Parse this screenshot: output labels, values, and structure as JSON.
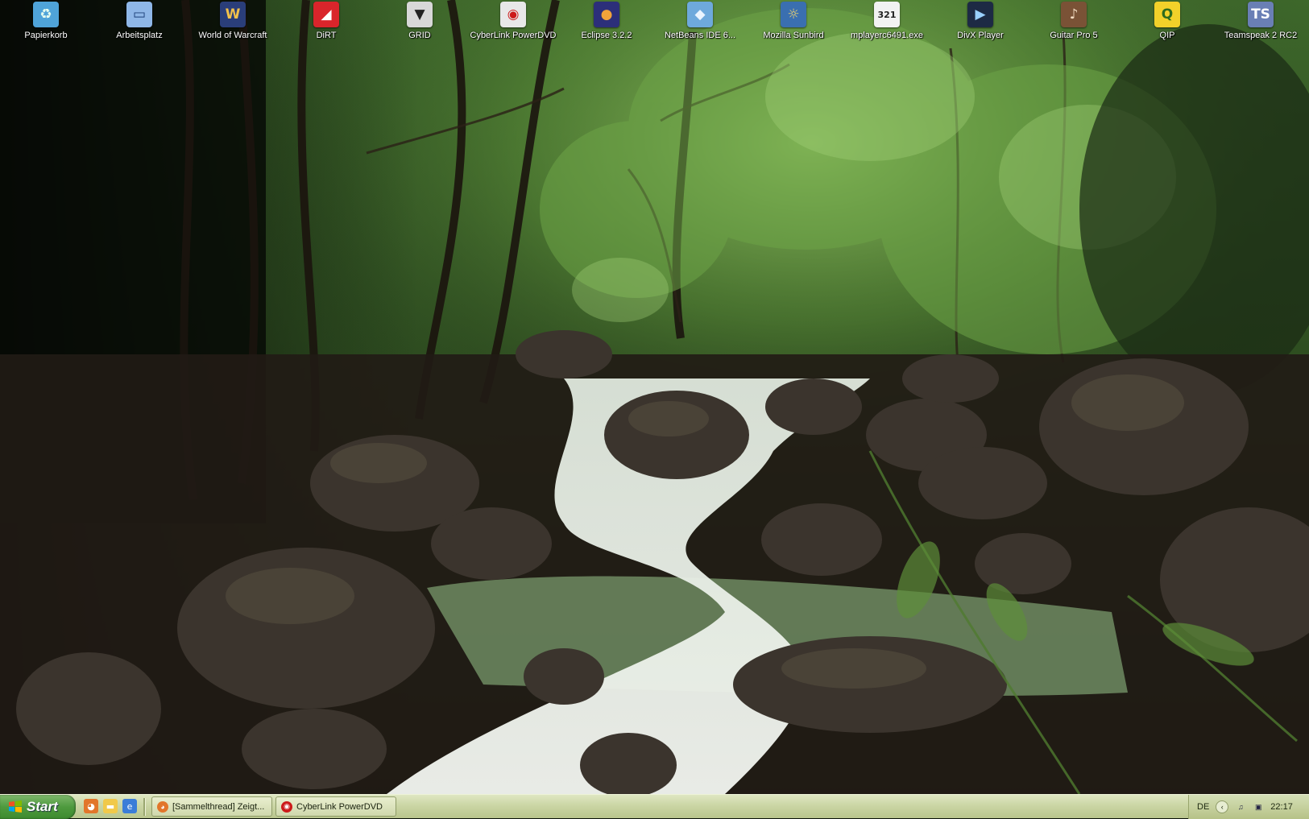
{
  "desktop": {
    "icons": [
      {
        "label": "Papierkorb",
        "icon": "recycle-bin-icon",
        "glyph": "♻",
        "bg": "#4fa3d9",
        "fg": "#e8fff0",
        "shortcut": false
      },
      {
        "label": "Arbeitsplatz",
        "icon": "my-computer-icon",
        "glyph": "▭",
        "bg": "#8fb7e8",
        "fg": "#1c3f78",
        "shortcut": false
      },
      {
        "label": "World of Warcraft",
        "icon": "world-of-warcraft-icon",
        "glyph": "W",
        "bg": "#2a3e7a",
        "fg": "#f2c14a",
        "shortcut": true
      },
      {
        "label": "DiRT",
        "icon": "dirt-icon",
        "glyph": "◢",
        "bg": "#d9252b",
        "fg": "#ffffff",
        "shortcut": true
      },
      {
        "label": "GRID",
        "icon": "grid-icon",
        "glyph": "▼",
        "bg": "#d8d8d8",
        "fg": "#222222",
        "shortcut": true
      },
      {
        "label": "CyberLink PowerDVD",
        "icon": "powerdvd-icon",
        "glyph": "◉",
        "bg": "#e8e8e8",
        "fg": "#cc1a1a",
        "shortcut": true
      },
      {
        "label": "Eclipse 3.2.2",
        "icon": "eclipse-icon",
        "glyph": "●",
        "bg": "#2c2f7a",
        "fg": "#f2a33a",
        "shortcut": true
      },
      {
        "label": "NetBeans IDE 6...",
        "icon": "netbeans-icon",
        "glyph": "◆",
        "bg": "#6ea9dc",
        "fg": "#eaf4ff",
        "shortcut": true
      },
      {
        "label": "Mozilla Sunbird",
        "icon": "sunbird-icon",
        "glyph": "☼",
        "bg": "#3a6fb0",
        "fg": "#f5d76e",
        "shortcut": true
      },
      {
        "label": "mplayerc6491.exe",
        "icon": "media-player-classic-icon",
        "glyph": "321",
        "bg": "#f2f2f2",
        "fg": "#222222",
        "shortcut": true
      },
      {
        "label": "DivX Player",
        "icon": "divx-player-icon",
        "glyph": "▶",
        "bg": "#1d2a44",
        "fg": "#9ad0ff",
        "shortcut": true
      },
      {
        "label": "Guitar Pro 5",
        "icon": "guitar-pro-icon",
        "glyph": "♪",
        "bg": "#7a5236",
        "fg": "#f3dcc2",
        "shortcut": true
      },
      {
        "label": "QIP",
        "icon": "qip-icon",
        "glyph": "Q",
        "bg": "#f2d12a",
        "fg": "#2d6b1e",
        "shortcut": true
      },
      {
        "label": "Teamspeak 2 RC2",
        "icon": "teamspeak-icon",
        "glyph": "TS",
        "bg": "#6a7fb5",
        "fg": "#ffffff",
        "shortcut": true
      }
    ]
  },
  "taskbar": {
    "start_label": "Start",
    "quicklaunch": [
      {
        "icon": "firefox-icon",
        "glyph": "◕",
        "bg": "#e2762a"
      },
      {
        "icon": "explorer-folder-icon",
        "glyph": "▬",
        "bg": "#f1c94a"
      },
      {
        "icon": "internet-explorer-icon",
        "glyph": "e",
        "bg": "#3b7dd8"
      }
    ],
    "tasks": [
      {
        "label": "[Sammelthread] Zeigt...",
        "icon": "firefox-icon",
        "glyph": "◕",
        "bg": "#e2762a"
      },
      {
        "label": "CyberLink PowerDVD",
        "icon": "powerdvd-icon",
        "glyph": "◉",
        "bg": "#cc1a1a"
      }
    ],
    "tray": {
      "language": "DE",
      "clock": "22:17",
      "icons": [
        {
          "icon": "show-hidden-icons-chevron",
          "glyph": "‹"
        },
        {
          "icon": "volume-icon",
          "glyph": "♫"
        },
        {
          "icon": "network-icon",
          "glyph": "▣"
        }
      ]
    }
  },
  "colors": {
    "taskbar": "#cbd6a5",
    "start_button": "#4e9a3e",
    "icon_label": "#ffffff"
  }
}
